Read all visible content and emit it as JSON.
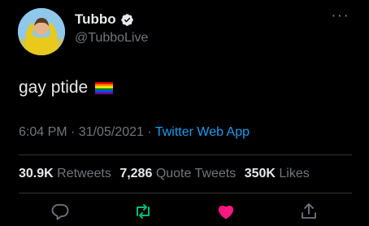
{
  "tweet": {
    "author": {
      "display_name": "Tubbo",
      "handle": "@TubboLive",
      "verified": true
    },
    "text": "gay ptide",
    "emoji": "rainbow-flag",
    "timestamp": "6:04 PM · 31/05/2021 · ",
    "source": "Twitter Web App",
    "stats": {
      "retweets_count": "30.9K",
      "retweets_label": "Retweets",
      "quote_count": "7,286",
      "quote_label": "Quote Tweets",
      "likes_count": "350K",
      "likes_label": "Likes"
    },
    "actions": [
      {
        "icon": "reply-icon"
      },
      {
        "icon": "retweet-icon",
        "color": "#00ba7c"
      },
      {
        "icon": "heart-icon",
        "color": "#f91880"
      },
      {
        "icon": "share-icon"
      }
    ]
  },
  "more_menu": "···",
  "colors": {
    "background": "#000000",
    "link": "#1d9bf0",
    "muted": "#71767b",
    "retweet": "#00ba7c",
    "like": "#f91880"
  }
}
